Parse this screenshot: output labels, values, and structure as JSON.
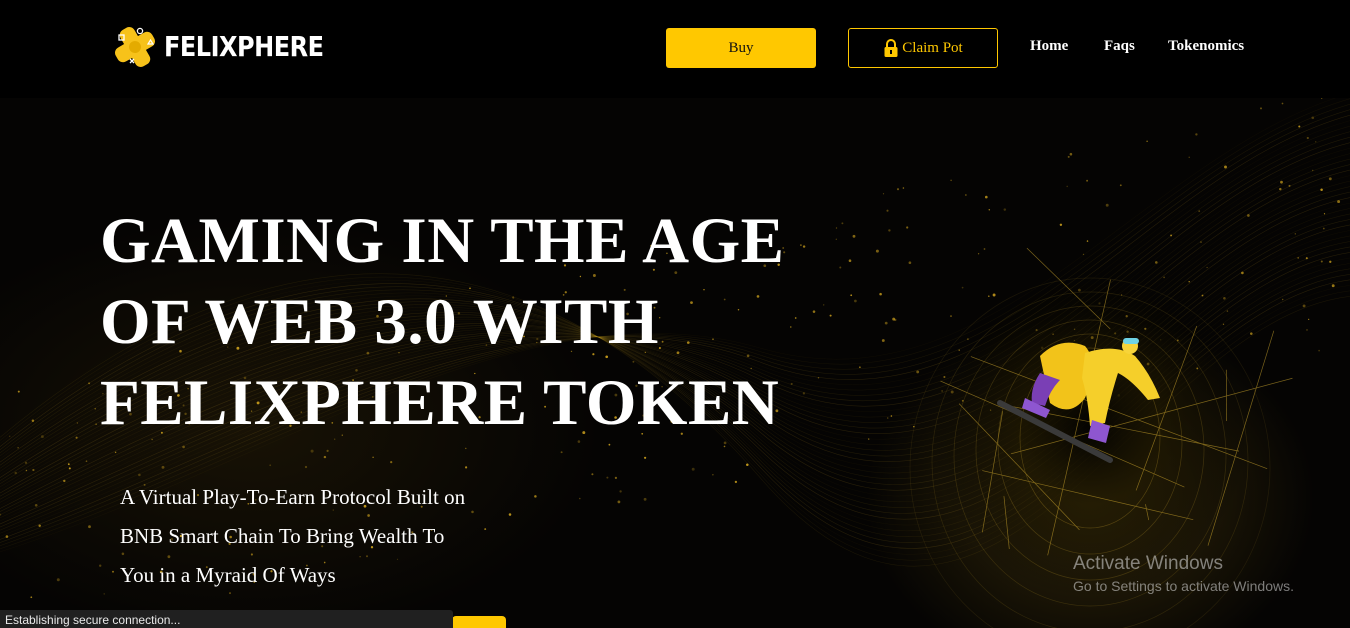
{
  "brand": {
    "name": "FELIXPHERE",
    "logo_icon": "gamepad-icon"
  },
  "header": {
    "buy_label": "Buy",
    "claim_label": "Claim Pot",
    "claim_icon": "lock-icon",
    "nav": [
      "Home",
      "Faqs",
      "Tokenomics"
    ]
  },
  "hero": {
    "headline_lines": [
      "GAMING IN THE AGE",
      "OF WEB 3.0 WITH",
      "FELIXPHERE TOKEN"
    ],
    "subtext_lines": [
      "A Virtual Play-To-Earn Protocol Built on",
      "BNB Smart Chain To Bring Wealth To",
      "You in a Myraid Of Ways"
    ],
    "illustration": "skateboarder-illustration"
  },
  "watermark": {
    "title": "Activate Windows",
    "subtitle": "Go to Settings to activate Windows."
  },
  "status_bar": {
    "text": "Establishing secure connection..."
  },
  "colors": {
    "accent": "#ffc800",
    "background": "#000000",
    "text": "#ffffff"
  }
}
